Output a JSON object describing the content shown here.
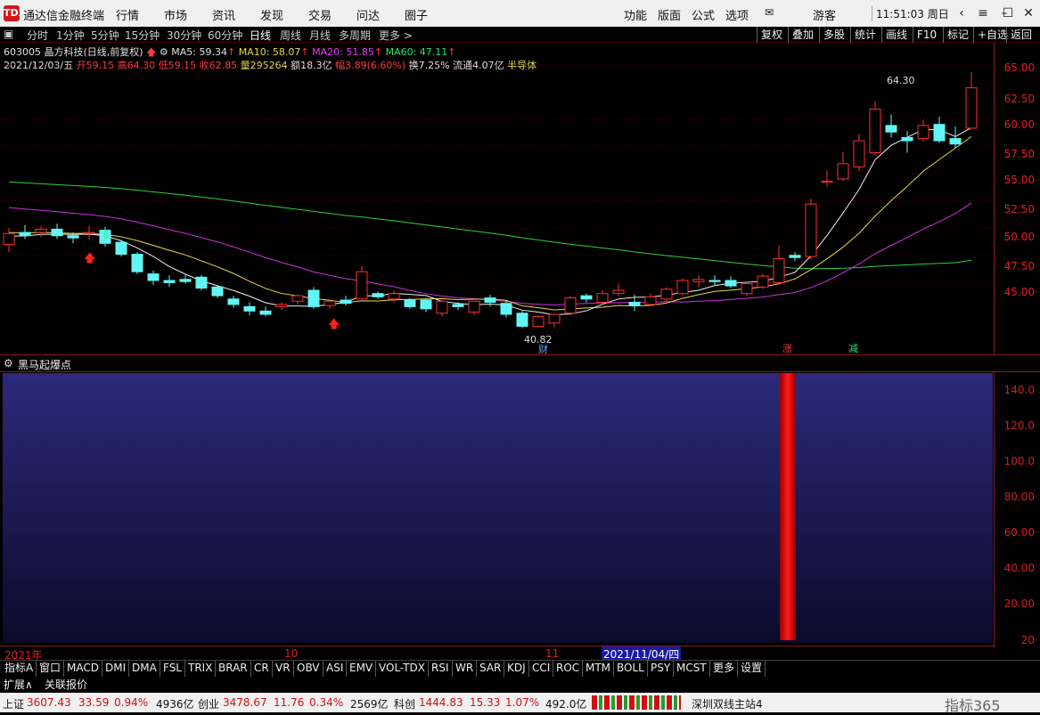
{
  "app": {
    "name": "通达信金融终端",
    "logo": "TDX"
  },
  "menu": [
    "行情",
    "市场",
    "资讯",
    "发现",
    "交易",
    "问达",
    "圈子"
  ],
  "menu_right": [
    "功能",
    "版面",
    "公式",
    "选项"
  ],
  "user": "游客",
  "clock": "11:51:03 周日",
  "window_buttons": [
    "chevron-left-icon",
    "menu-icon",
    "minimize-icon",
    "maximize-icon",
    "close-icon"
  ],
  "periods": [
    "分时",
    "1分钟",
    "5分钟",
    "15分钟",
    "30分钟",
    "60分钟",
    "日线",
    "周线",
    "月线",
    "多周期",
    "更多 >"
  ],
  "active_period": "日线",
  "right_buttons": [
    "复权",
    "叠加",
    "多股",
    "统计",
    "画线",
    "F10",
    "标记",
    "+自选",
    "返回"
  ],
  "stock": {
    "code_name": "603005 晶方科技(日线,前复权)",
    "ma5": "MA5: 59.34",
    "ma10": "MA10: 58.07",
    "ma20": "MA20: 51.85",
    "ma60": "MA60: 47.11"
  },
  "quote": {
    "date": "2021/12/03/五",
    "open_l": "开",
    "open": "59.15",
    "high_l": "高",
    "high": "64.30",
    "low_l": "低",
    "low": "59.15",
    "close_l": "收",
    "close": "62.85",
    "vol_l": "量",
    "vol": "295264",
    "amt": "额18.3亿",
    "amp_l": "幅",
    "amp": "3.89(6.60%)",
    "turnover": "换7.25%",
    "float": "流通4.07亿",
    "sector": "半导体"
  },
  "price_axis": [
    "65.00",
    "62.50",
    "60.00",
    "57.50",
    "55.00",
    "52.50",
    "50.00",
    "47.50",
    "45.00"
  ],
  "annotations": {
    "high": "64.30",
    "low": "40.82",
    "cai": "财",
    "zhang": "涨",
    "jian": "减"
  },
  "indicator": {
    "name": "黑马起爆点",
    "axis": [
      "140.0",
      "120.0",
      "100.0",
      "80.00",
      "60.00",
      "40.00",
      "20.00",
      "20"
    ],
    "value": 150
  },
  "dates": {
    "year": "2021年",
    "oct": "10",
    "nov": "11",
    "cursor": "2021/11/04/四"
  },
  "tabs": [
    "指标A",
    "窗口",
    "MACD",
    "DMI",
    "DMA",
    "FSL",
    "TRIX",
    "BRAR",
    "CR",
    "VR",
    "OBV",
    "ASI",
    "EMV",
    "VOL-TDX",
    "RSI",
    "WR",
    "SAR",
    "KDJ",
    "CCI",
    "ROC",
    "MTM",
    "BOLL",
    "PSY",
    "MCST",
    "更多",
    "设置"
  ],
  "ext": [
    "扩展∧",
    "关联报价"
  ],
  "status": {
    "sh_l": "上证",
    "sh": "3607.43",
    "sh_c": "33.59",
    "sh_p": "0.94%",
    "sh_a": "4936亿",
    "cy_l": "创业",
    "cy": "3478.67",
    "cy_c": "11.76",
    "cy_p": "0.34%",
    "cy_a": "2569亿",
    "kc_l": "科创",
    "kc": "1444.83",
    "kc_c": "15.33",
    "kc_p": "1.07%",
    "kc_a": "492.0亿",
    "station": "深圳双线主站4",
    "watermark": "指标365"
  },
  "chart_data": {
    "type": "candlestick",
    "ylim": [
      40,
      66
    ],
    "ohlc": [
      [
        48.5,
        50.0,
        47.8,
        49.5
      ],
      [
        49.6,
        50.3,
        49.0,
        49.3
      ],
      [
        49.6,
        50.2,
        49.2,
        49.9
      ],
      [
        49.9,
        50.4,
        49.0,
        49.3
      ],
      [
        49.3,
        49.6,
        48.6,
        49.1
      ],
      [
        49.5,
        50.2,
        48.9,
        49.6
      ],
      [
        49.8,
        50.1,
        48.3,
        48.6
      ],
      [
        48.7,
        48.9,
        47.4,
        47.6
      ],
      [
        47.6,
        47.8,
        45.8,
        46.0
      ],
      [
        45.8,
        46.1,
        44.8,
        45.2
      ],
      [
        45.2,
        45.7,
        44.6,
        45.0
      ],
      [
        45.3,
        45.7,
        44.9,
        45.1
      ],
      [
        45.5,
        45.7,
        44.3,
        44.5
      ],
      [
        44.6,
        44.8,
        43.6,
        43.8
      ],
      [
        43.5,
        43.8,
        42.7,
        43.0
      ],
      [
        42.8,
        43.2,
        42.0,
        42.4
      ],
      [
        42.4,
        42.8,
        41.9,
        42.1
      ],
      [
        42.8,
        43.2,
        42.5,
        43.0
      ],
      [
        43.3,
        43.9,
        43.0,
        43.8
      ],
      [
        44.3,
        44.6,
        42.6,
        42.8
      ],
      [
        42.9,
        43.5,
        42.6,
        43.3
      ],
      [
        43.4,
        43.8,
        42.9,
        43.1
      ],
      [
        43.5,
        46.5,
        43.3,
        46.0
      ],
      [
        44.0,
        44.2,
        43.5,
        43.7
      ],
      [
        43.5,
        44.3,
        43.2,
        44.0
      ],
      [
        43.4,
        43.6,
        42.6,
        42.8
      ],
      [
        43.4,
        43.6,
        42.3,
        42.6
      ],
      [
        42.2,
        43.4,
        41.9,
        43.3
      ],
      [
        43.0,
        43.2,
        42.5,
        42.8
      ],
      [
        42.3,
        43.3,
        42.0,
        43.3
      ],
      [
        43.6,
        43.9,
        42.8,
        43.2
      ],
      [
        43.1,
        43.4,
        41.8,
        42.1
      ],
      [
        42.2,
        42.4,
        40.82,
        41.0
      ],
      [
        41.0,
        42.0,
        40.9,
        41.9
      ],
      [
        41.3,
        42.2,
        40.9,
        42.1
      ],
      [
        42.2,
        43.8,
        42.0,
        43.6
      ],
      [
        43.8,
        44.0,
        43.2,
        43.5
      ],
      [
        43.2,
        44.3,
        43.0,
        44.0
      ],
      [
        44.0,
        44.9,
        43.8,
        44.3
      ],
      [
        43.2,
        43.9,
        42.4,
        42.9
      ],
      [
        43.0,
        44.0,
        42.9,
        43.7
      ],
      [
        43.5,
        44.6,
        43.2,
        44.4
      ],
      [
        44.0,
        45.4,
        43.8,
        45.2
      ],
      [
        45.1,
        45.7,
        44.6,
        45.3
      ],
      [
        45.2,
        45.7,
        44.8,
        45.1
      ],
      [
        45.2,
        45.6,
        44.5,
        44.7
      ],
      [
        44.0,
        45.0,
        43.8,
        44.9
      ],
      [
        44.6,
        45.8,
        44.4,
        45.6
      ],
      [
        45.0,
        48.4,
        44.8,
        47.2
      ],
      [
        47.5,
        47.8,
        47.0,
        47.3
      ],
      [
        47.4,
        52.7,
        47.1,
        52.2
      ],
      [
        54.2,
        55.3,
        53.8,
        54.3
      ],
      [
        54.5,
        57.0,
        54.3,
        55.9
      ],
      [
        55.6,
        58.6,
        55.2,
        58.0
      ],
      [
        56.9,
        61.6,
        56.6,
        60.9
      ],
      [
        59.4,
        60.4,
        58.3,
        58.8
      ],
      [
        58.3,
        58.9,
        56.9,
        58.0
      ],
      [
        58.2,
        59.9,
        57.9,
        59.4
      ],
      [
        59.5,
        60.2,
        57.8,
        58.0
      ],
      [
        58.2,
        59.3,
        57.3,
        57.7
      ],
      [
        59.15,
        64.3,
        59.15,
        62.85
      ]
    ]
  }
}
